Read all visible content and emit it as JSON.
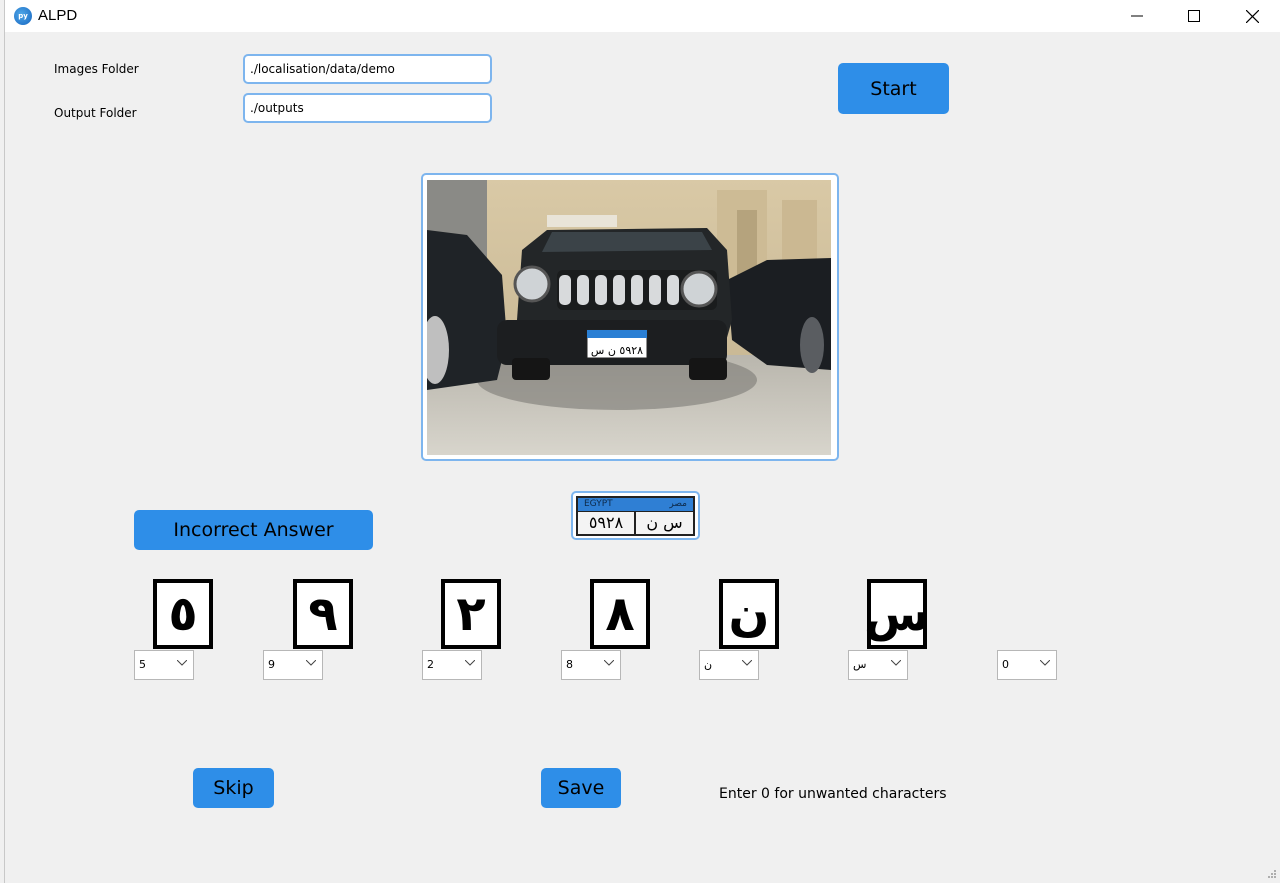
{
  "window": {
    "title": "ALPD",
    "app_icon_text": "py"
  },
  "form": {
    "images_folder_label": "Images Folder",
    "images_folder_value": "./localisation/data/demo",
    "output_folder_label": "Output Folder",
    "output_folder_value": "./outputs",
    "start_label": "Start"
  },
  "plate": {
    "country_en": "EGYPT",
    "country_ar": "مصر",
    "numbers": "٥٩٢٨",
    "letters": "س ن"
  },
  "actions": {
    "incorrect_label": "Incorrect Answer",
    "skip_label": "Skip",
    "save_label": "Save",
    "hint": "Enter 0 for unwanted characters"
  },
  "characters": [
    {
      "glyph": "٥",
      "value": "5"
    },
    {
      "glyph": "٩",
      "value": "9"
    },
    {
      "glyph": "٢",
      "value": "2"
    },
    {
      "glyph": "٨",
      "value": "8"
    },
    {
      "glyph": "ن",
      "value": "ن"
    },
    {
      "glyph": "س",
      "value": "س"
    },
    {
      "glyph": "",
      "value": "0"
    }
  ],
  "colors": {
    "accent": "#2e8ee8",
    "border": "#7db5ee",
    "background": "#f0f0f0"
  }
}
